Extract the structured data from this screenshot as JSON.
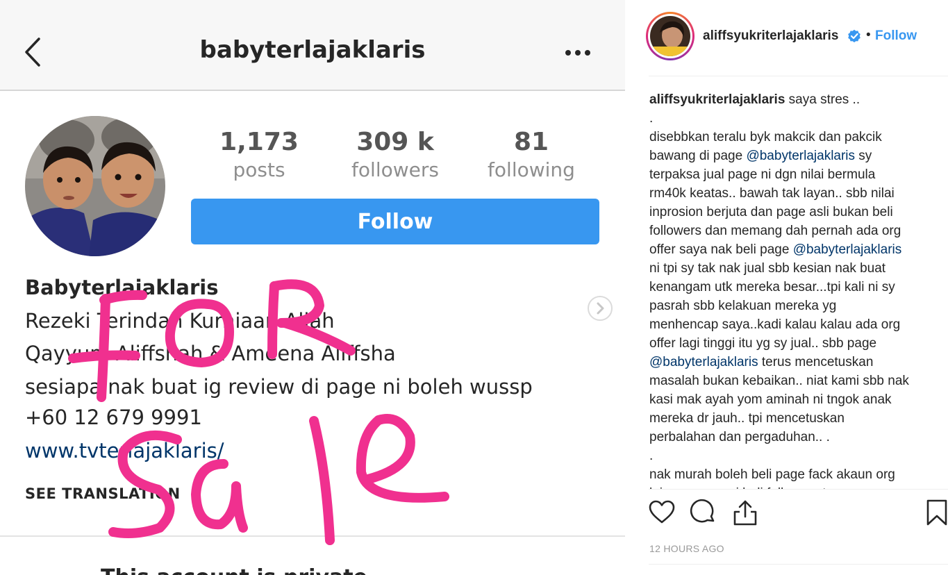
{
  "screenshot": {
    "profile_username": "babyterlajaklaris",
    "stats": [
      {
        "value": "1,173",
        "label": "posts"
      },
      {
        "value": "309 k",
        "label": "followers"
      },
      {
        "value": "81",
        "label": "following"
      }
    ],
    "follow_label": "Follow",
    "display_name": "Babyterlajaklaris",
    "bio_lines": [
      "Rezeki Terindah Kurniaan Allah",
      "Qayyum Aliffshah & Ameena Aliffsha",
      "sesiapa nak buat ig review di page ni boleh wussp"
    ],
    "phone": "+60 12 679 9991",
    "website": "www.tvterlajaklaris/",
    "see_translation": "SEE TRANSLATION",
    "cut_off_text": "This account is private",
    "overlay_text": "FOR SALE",
    "overlay_color": "#f0308f"
  },
  "post": {
    "author": "aliffsyukriterlajaklaris",
    "follow_label": "Follow",
    "separator": "•",
    "verified_color": "#3897f0",
    "caption_lines": [
      {
        "parts": [
          {
            "text": "aliffsyukriterlajaklaris",
            "style": "b"
          },
          {
            "text": " saya stres .."
          }
        ]
      },
      {
        "parts": [
          {
            "text": "."
          }
        ]
      },
      {
        "parts": [
          {
            "text": "disebbkan teralu byk makcik dan pakcik"
          }
        ]
      },
      {
        "parts": [
          {
            "text": "bawang di page "
          },
          {
            "text": "@babyterlajaklaris",
            "style": "mention"
          },
          {
            "text": " sy"
          }
        ]
      },
      {
        "parts": [
          {
            "text": "terpaksa jual page ni dgn nilai bermula"
          }
        ]
      },
      {
        "parts": [
          {
            "text": "rm40k keatas.. bawah tak layan.. sbb nilai"
          }
        ]
      },
      {
        "parts": [
          {
            "text": "inprosion berjuta dan page asli bukan beli"
          }
        ]
      },
      {
        "parts": [
          {
            "text": "followers dan memang dah pernah ada org"
          }
        ]
      },
      {
        "parts": [
          {
            "text": "offer saya nak beli page "
          },
          {
            "text": "@babyterlajaklaris",
            "style": "mention"
          }
        ]
      },
      {
        "parts": [
          {
            "text": "ni tpi sy tak nak jual sbb kesian nak buat"
          }
        ]
      },
      {
        "parts": [
          {
            "text": "kenangam utk mereka besar...tpi kali ni sy"
          }
        ]
      },
      {
        "parts": [
          {
            "text": "pasrah sbb kelakuan mereka yg"
          }
        ]
      },
      {
        "parts": [
          {
            "text": "menhencap saya..kadi kalau kalau ada org"
          }
        ]
      },
      {
        "parts": [
          {
            "text": "offer lagi tinggi itu yg sy jual.. sbb page"
          }
        ]
      },
      {
        "parts": [
          {
            "text": "@babyterlajaklaris",
            "style": "mention"
          },
          {
            "text": " terus mencetuskan"
          }
        ]
      },
      {
        "parts": [
          {
            "text": "masalah bukan kebaikan.. niat kami sbb nak"
          }
        ]
      },
      {
        "parts": [
          {
            "text": "kasi mak ayah yom aminah ni tngok anak"
          }
        ]
      },
      {
        "parts": [
          {
            "text": "mereka dr jauh.. tpi mencetuskan"
          }
        ]
      },
      {
        "parts": [
          {
            "text": "perbalahan dan pergaduhan.. ."
          }
        ]
      },
      {
        "parts": [
          {
            "text": "."
          }
        ]
      },
      {
        "parts": [
          {
            "text": "nak murah boleh beli page fack akaun org"
          }
        ]
      },
      {
        "parts": [
          {
            "text": "lain yang ramai beli followers tu"
          }
        ]
      }
    ],
    "timestamp": "12 HOURS AGO",
    "icons": [
      "heart-icon",
      "comment-icon",
      "share-icon",
      "bookmark-icon"
    ]
  }
}
